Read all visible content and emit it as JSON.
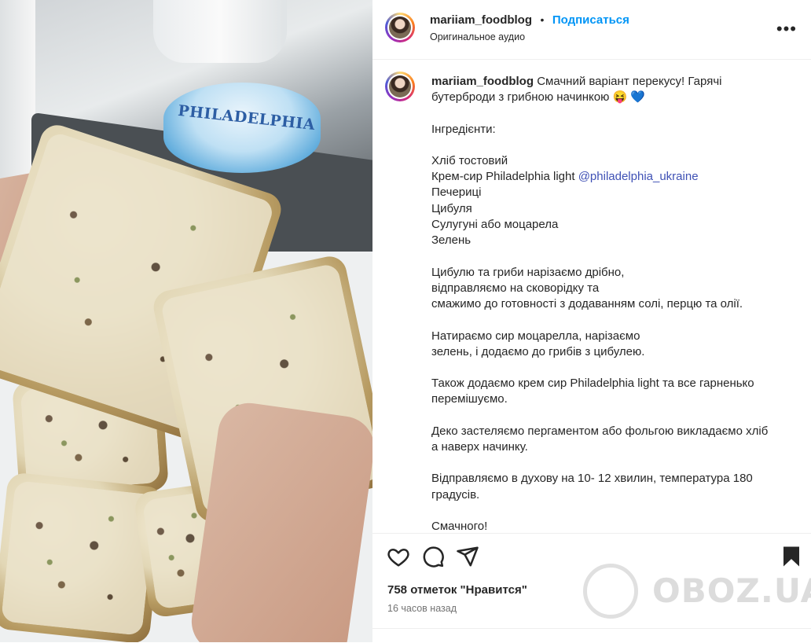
{
  "photo": {
    "brand_text": "PHILADELPHIA"
  },
  "header": {
    "username": "mariiam_foodblog",
    "separator": "•",
    "follow_label": "Подписаться",
    "audio_label": "Оригинальное аудио",
    "more_label": "•••"
  },
  "caption": {
    "username": "mariiam_foodblog",
    "intro": "Смачний варіант перекусу! Гарячі бутерброди з грибною начинкою 😝 💙",
    "ingredients_title": "Інгредієнти:",
    "ingredient_1": "Хліб тостовий",
    "ingredient_2": "Крем-сир Philadelphia light ",
    "mention": "@philadelphia_ukraine",
    "ingredient_3": "Печериці",
    "ingredient_4": "Цибуля",
    "ingredient_5": "Сулугуні або моцарела",
    "ingredient_6": "Зелень",
    "step_1": "Цибулю та гриби нарізаємо дрібно,\nвідправляємо на сковорідку та\nсмажимо до готовності з додаванням солі, перцю та олії.",
    "step_2": "Натираємо сир моцарелла, нарізаємо\nзелень, і додаємо до грибів з цибулею.",
    "step_3": "Також додаємо крем сир Philadelphia light та все гарненько\nперемішуємо.",
    "step_4": "Деко застеляємо пергаментом або фольгою викладаємо хліб\nа наверх начинку.",
    "step_5": "Відправляємо в духову на 10- 12 хвилин, температура 180\nградусів.",
    "ending": "Смачного!"
  },
  "actions": {
    "likes": "758 отметок \"Нравится\"",
    "time": "16 часов назад"
  },
  "watermark": {
    "text": "OBOZ.UA"
  }
}
